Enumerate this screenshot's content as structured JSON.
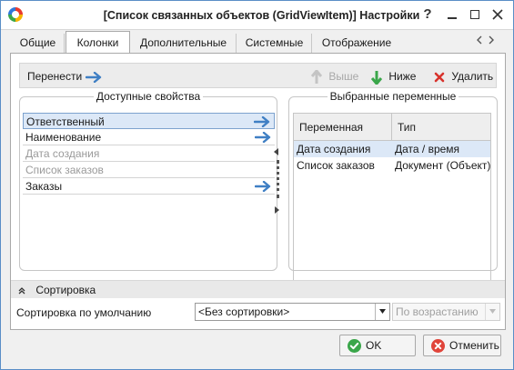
{
  "window": {
    "title": "[Список связанных объектов (GridViewItem)] Настройки",
    "help_glyph": "?",
    "icons": [
      "app-logo-icon",
      "help-icon",
      "minimize-icon",
      "maximize-icon",
      "close-icon"
    ]
  },
  "tabs": [
    {
      "label": "Общие",
      "active": false
    },
    {
      "label": "Колонки",
      "active": true
    },
    {
      "label": "Дополнительные",
      "active": false
    },
    {
      "label": "Системные",
      "active": false
    },
    {
      "label": "Отображение",
      "active": false
    }
  ],
  "toolbar": {
    "move_label": "Перенести",
    "up_label": "Выше",
    "down_label": "Ниже",
    "delete_label": "Удалить"
  },
  "available": {
    "title": "Доступные свойства",
    "items": [
      {
        "label": "Ответственный",
        "selected": true,
        "enabled": true,
        "arrow": true
      },
      {
        "label": "Наименование",
        "selected": false,
        "enabled": true,
        "arrow": true
      },
      {
        "label": "Дата создания",
        "selected": false,
        "enabled": false,
        "arrow": false
      },
      {
        "label": "Список заказов",
        "selected": false,
        "enabled": false,
        "arrow": false
      },
      {
        "label": "Заказы",
        "selected": false,
        "enabled": true,
        "arrow": true
      }
    ]
  },
  "selected": {
    "title": "Выбранные переменные",
    "columns": [
      "Переменная",
      "Тип"
    ],
    "rows": [
      {
        "name": "Дата создания",
        "type": "Дата / время",
        "selected": true
      },
      {
        "name": "Список заказов",
        "type": "Документ (Объект)",
        "selected": false
      }
    ]
  },
  "sort": {
    "header": "Сортировка",
    "default_label": "Сортировка по умолчанию",
    "sort_value": "<Без сортировки>",
    "direction_value": "По возрастанию"
  },
  "buttons": {
    "ok": "OK",
    "cancel": "Отменить"
  },
  "colors": {
    "accent": "#3f7fc4",
    "selection": "#dce8f7",
    "ok_green": "#3aa64a",
    "cancel_red": "#e0443a",
    "delete_red": "#d8322c"
  }
}
